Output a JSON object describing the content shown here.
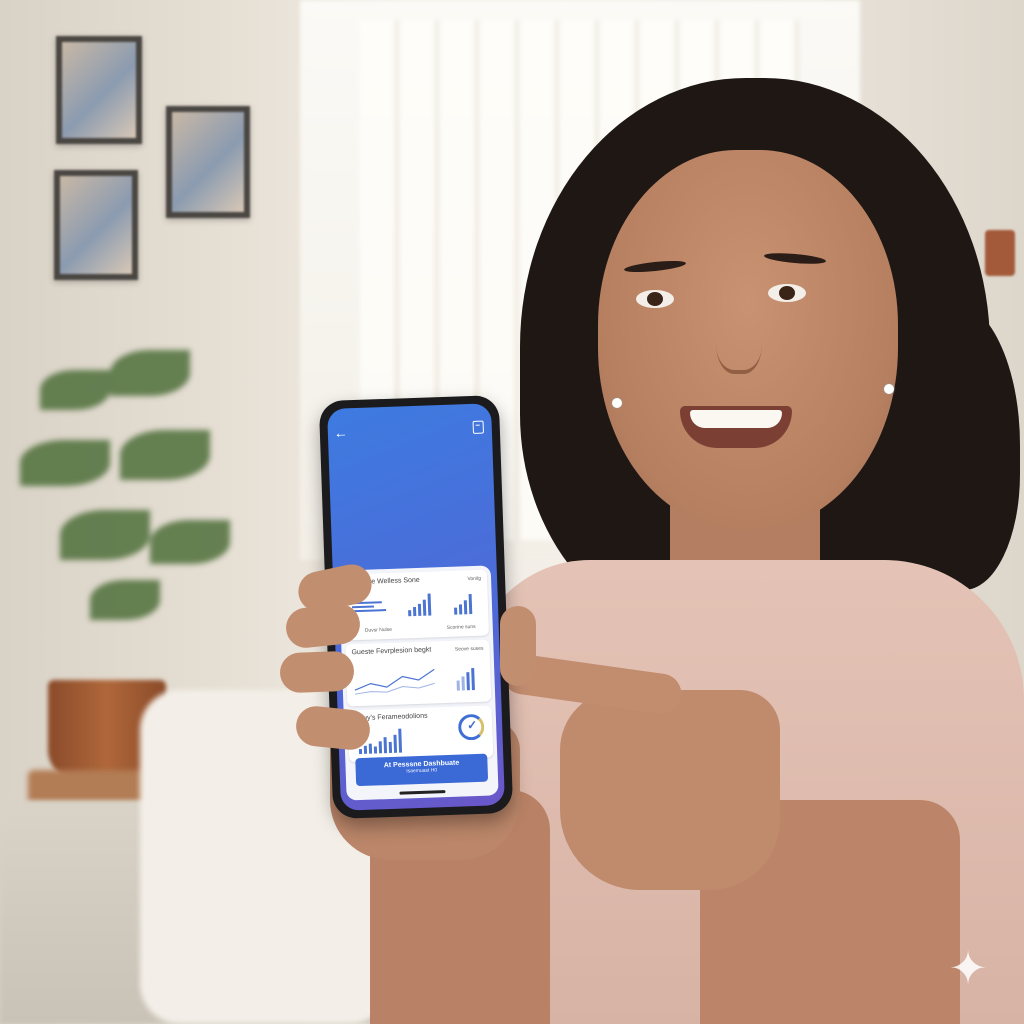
{
  "scene": {
    "description_tag": "woman-holding-phone-app",
    "watermark_icon": "sparkle-icon"
  },
  "app": {
    "back_icon": "arrow-left-icon",
    "share_icon": "share-icon",
    "cards": [
      {
        "title": "Heneste Welless Sone",
        "corner_label": "Vonilg",
        "footer_left": "Duvsr Nulse",
        "footer_right": "Scorine suns"
      },
      {
        "title": "Gueste Fevrplesion begkt",
        "corner_label": "Seove suses"
      },
      {
        "title": "Lleuy's Ferameodolions"
      }
    ],
    "cta": {
      "line1": "At Pesssne Dashbuate",
      "line2": "Isaemuast H0"
    }
  },
  "colors": {
    "phone_screen_top": "#3d7be0",
    "phone_screen_bottom": "#6a57c9",
    "accent": "#3b6ad6",
    "shirt": "#e4c3b6"
  }
}
